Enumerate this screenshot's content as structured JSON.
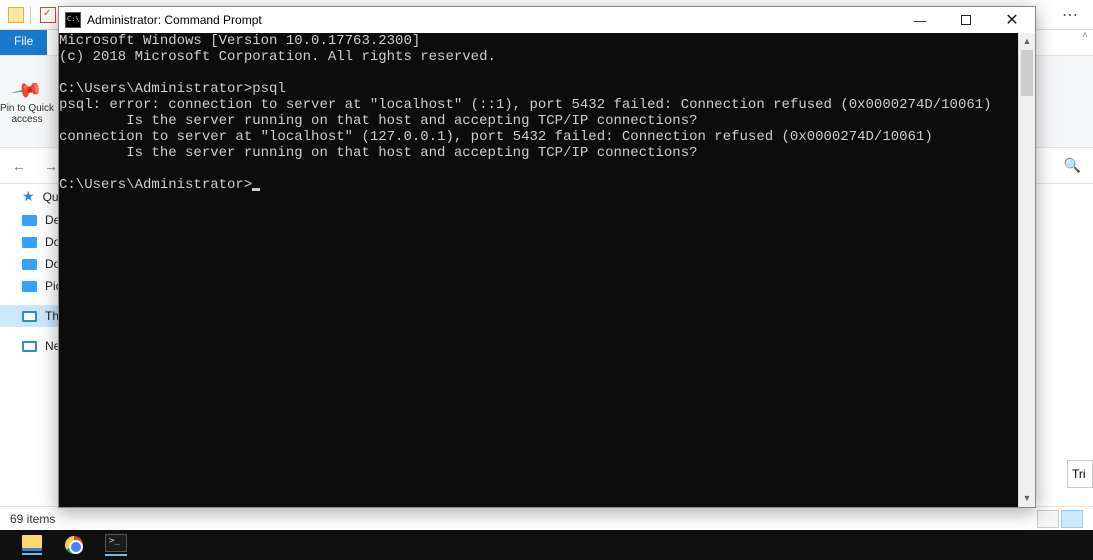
{
  "explorer": {
    "file_tab": "File",
    "pin_label": "Pin to Quick access",
    "sidebar": {
      "items": [
        {
          "label": "Quick access",
          "icon": "star"
        },
        {
          "label": "Desktop",
          "icon": "folder"
        },
        {
          "label": "Downloads",
          "icon": "folder"
        },
        {
          "label": "Documents",
          "icon": "folder"
        },
        {
          "label": "Pictures",
          "icon": "folder"
        },
        {
          "label": "This PC",
          "icon": "monitor"
        },
        {
          "label": "Network",
          "icon": "monitor"
        }
      ]
    },
    "status": {
      "item_count": "69 items"
    },
    "right_fragment": "Tri"
  },
  "cmd": {
    "title": "Administrator: Command Prompt",
    "lines": [
      "Microsoft Windows [Version 10.0.17763.2300]",
      "(c) 2018 Microsoft Corporation. All rights reserved.",
      "",
      "C:\\Users\\Administrator>psql",
      "psql: error: connection to server at \"localhost\" (::1), port 5432 failed: Connection refused (0x0000274D/10061)",
      "        Is the server running on that host and accepting TCP/IP connections?",
      "connection to server at \"localhost\" (127.0.0.1), port 5432 failed: Connection refused (0x0000274D/10061)",
      "        Is the server running on that host and accepting TCP/IP connections?",
      "",
      "C:\\Users\\Administrator>"
    ]
  }
}
